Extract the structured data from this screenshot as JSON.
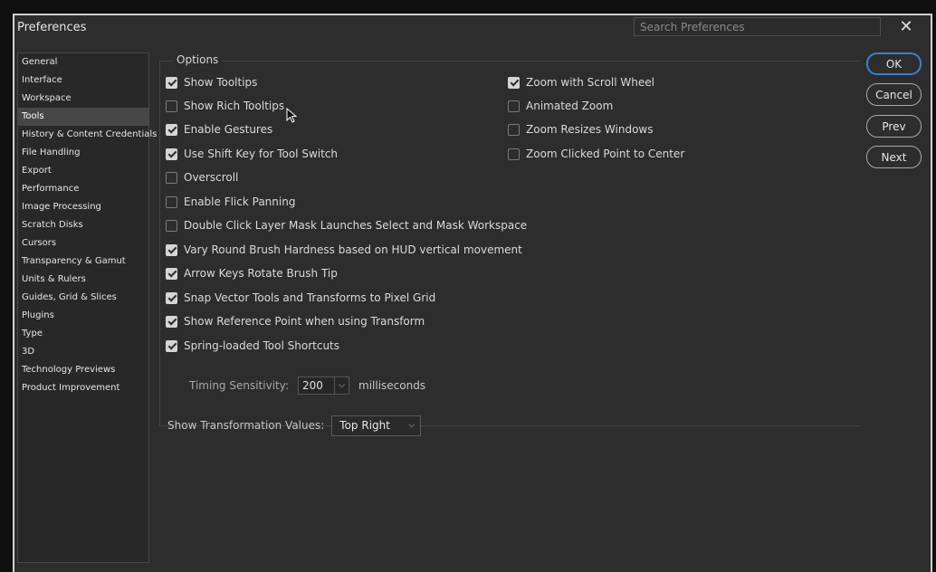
{
  "window": {
    "title": "Preferences",
    "search_placeholder": "Search Preferences",
    "close_glyph": "✕"
  },
  "sidebar": {
    "active": "Tools",
    "items": [
      "General",
      "Interface",
      "Workspace",
      "Tools",
      "History & Content Credentials",
      "File Handling",
      "Export",
      "Performance",
      "Image Processing",
      "Scratch Disks",
      "Cursors",
      "Transparency & Gamut",
      "Units & Rulers",
      "Guides, Grid & Slices",
      "Plugins",
      "Type",
      "3D",
      "Technology Previews",
      "Product Improvement"
    ]
  },
  "options": {
    "legend": "Options",
    "left_column": [
      {
        "label": "Show Tooltips",
        "checked": true
      },
      {
        "label": "Show Rich Tooltips",
        "checked": false
      },
      {
        "label": "Enable Gestures",
        "checked": true
      },
      {
        "label": "Use Shift Key for Tool Switch",
        "checked": true
      },
      {
        "label": "Overscroll",
        "checked": false
      },
      {
        "label": "Enable Flick Panning",
        "checked": false
      },
      {
        "label": "Double Click Layer Mask Launches Select and Mask Workspace",
        "checked": false
      },
      {
        "label": "Vary Round Brush Hardness based on HUD vertical movement",
        "checked": true
      },
      {
        "label": "Arrow Keys Rotate Brush Tip",
        "checked": true
      },
      {
        "label": "Snap Vector Tools and Transforms to Pixel Grid",
        "checked": true
      },
      {
        "label": "Show Reference Point when using Transform",
        "checked": true
      },
      {
        "label": "Spring-loaded Tool Shortcuts",
        "checked": true
      }
    ],
    "right_column": [
      {
        "label": "Zoom with Scroll Wheel",
        "checked": true
      },
      {
        "label": "Animated Zoom",
        "checked": false
      },
      {
        "label": "Zoom Resizes Windows",
        "checked": false
      },
      {
        "label": "Zoom Clicked Point to Center",
        "checked": false
      }
    ],
    "timing": {
      "label": "Timing Sensitivity:",
      "value": "200",
      "unit": "milliseconds"
    },
    "transformation": {
      "label": "Show Transformation Values:",
      "value": "Top Right"
    }
  },
  "buttons": {
    "ok": "OK",
    "cancel": "Cancel",
    "prev": "Prev",
    "next": "Next"
  },
  "colors": {
    "accent": "#3d7ed4",
    "panel": "#2d2d2d",
    "active_item": "#474747"
  }
}
